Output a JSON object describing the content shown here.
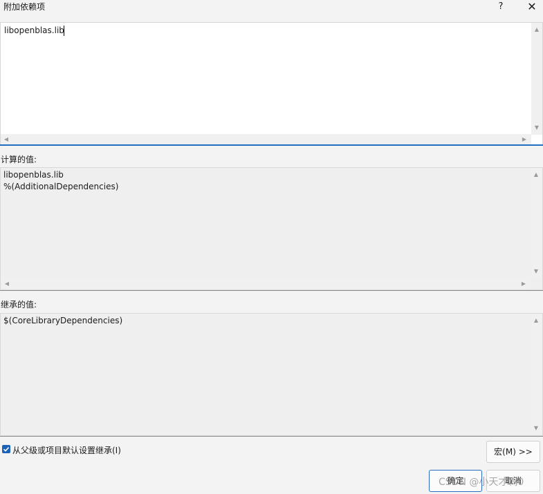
{
  "window": {
    "title": "附加依赖项",
    "help_glyph": "?",
    "close_glyph": "✕"
  },
  "editor": {
    "value": "libopenblas.lib"
  },
  "computed": {
    "label": "计算的值:",
    "lines": [
      "libopenblas.lib",
      "%(AdditionalDependencies)"
    ]
  },
  "inherited": {
    "label": "继承的值:",
    "lines": [
      "$(CoreLibraryDependencies)"
    ]
  },
  "inherit_checkbox": {
    "label": "从父级或项目默认设置继承(I)",
    "checked": true
  },
  "buttons": {
    "macro": "宏(M) >>",
    "ok": "确定",
    "cancel": "取消"
  },
  "watermark": "CSDN @小天才鸭0"
}
